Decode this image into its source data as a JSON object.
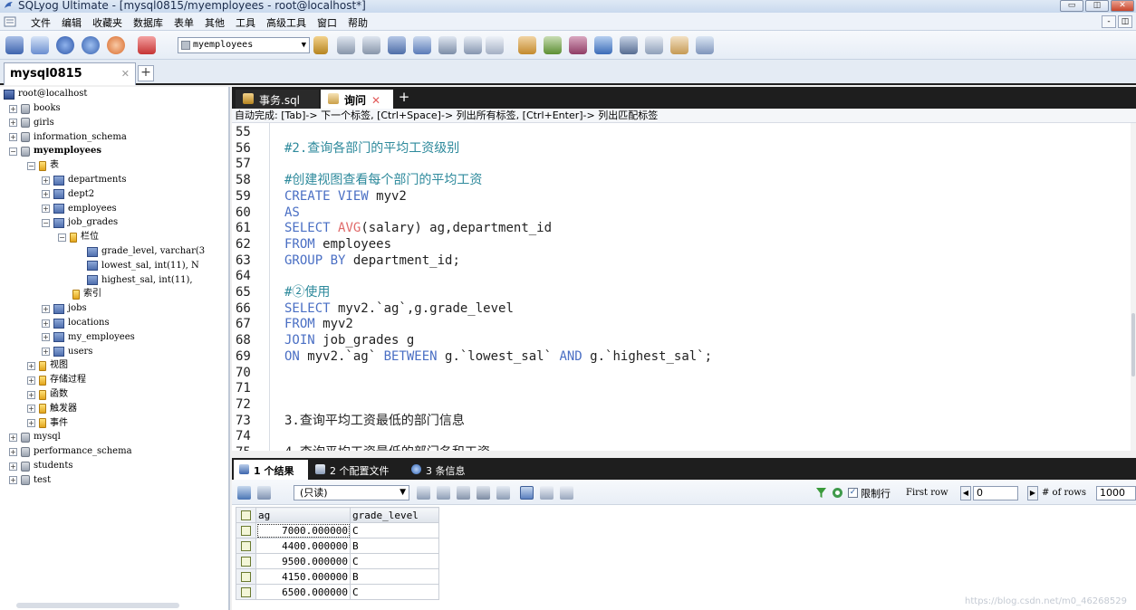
{
  "window": {
    "title": "SQLyog Ultimate - [mysql0815/myemployees - root@localhost*]",
    "buttons": [
      "▭",
      "◫",
      "✕"
    ]
  },
  "menu": {
    "items": [
      "文件",
      "编辑",
      "收藏夹",
      "数据库",
      "表单",
      "其他",
      "工具",
      "高级工具",
      "窗口",
      "帮助"
    ],
    "mdi_buttons": [
      "-",
      "◫"
    ]
  },
  "toolbar": {
    "database_select": "myemployees",
    "dropdown_arrow": "▼"
  },
  "connection_tabs": {
    "active": "mysql0815",
    "close": "✕",
    "add": "+"
  },
  "tree": {
    "server": "root@localhost",
    "nodes": [
      {
        "label": "books",
        "exp": "+",
        "type": "db"
      },
      {
        "label": "girls",
        "exp": "+",
        "type": "db"
      },
      {
        "label": "information_schema",
        "exp": "+",
        "type": "db"
      },
      {
        "label": "myemployees",
        "exp": "−",
        "type": "db"
      },
      {
        "label": "表",
        "exp": "−",
        "type": "folder"
      },
      {
        "label": "departments",
        "exp": "+",
        "type": "table"
      },
      {
        "label": "dept2",
        "exp": "+",
        "type": "table"
      },
      {
        "label": "employees",
        "exp": "+",
        "type": "table"
      },
      {
        "label": "job_grades",
        "exp": "−",
        "type": "table"
      },
      {
        "label": "栏位",
        "exp": "−",
        "type": "folder"
      },
      {
        "label": "grade_level, varchar(3",
        "exp": "",
        "type": "table"
      },
      {
        "label": "lowest_sal, int(11), N",
        "exp": "",
        "type": "table"
      },
      {
        "label": "highest_sal, int(11),",
        "exp": "",
        "type": "table"
      },
      {
        "label": "索引",
        "exp": "",
        "type": "folder"
      },
      {
        "label": "jobs",
        "exp": "+",
        "type": "table"
      },
      {
        "label": "locations",
        "exp": "+",
        "type": "table"
      },
      {
        "label": "my_employees",
        "exp": "+",
        "type": "table"
      },
      {
        "label": "users",
        "exp": "+",
        "type": "table"
      },
      {
        "label": "视图",
        "exp": "+",
        "type": "folder"
      },
      {
        "label": "存储过程",
        "exp": "+",
        "type": "folder"
      },
      {
        "label": "函数",
        "exp": "+",
        "type": "folder"
      },
      {
        "label": "触发器",
        "exp": "+",
        "type": "folder"
      },
      {
        "label": "事件",
        "exp": "+",
        "type": "folder"
      },
      {
        "label": "mysql",
        "exp": "+",
        "type": "db"
      },
      {
        "label": "performance_schema",
        "exp": "+",
        "type": "db"
      },
      {
        "label": "students",
        "exp": "+",
        "type": "db"
      },
      {
        "label": "test",
        "exp": "+",
        "type": "db"
      }
    ]
  },
  "query_tabs": {
    "inactive": "事务.sql",
    "active": "询问",
    "close": "✕",
    "add": "+"
  },
  "hint": "自动完成: [Tab]-> 下一个标签, [Ctrl+Space]-> 列出所有标签, [Ctrl+Enter]-> 列出匹配标签",
  "editor": {
    "lines": [
      {
        "n": "55",
        "html": ""
      },
      {
        "n": "56",
        "html": "<span class='cmt'>#2.查询各部门的平均工资级别</span>"
      },
      {
        "n": "57",
        "html": ""
      },
      {
        "n": "58",
        "html": "<span class='cmt'>#创建视图查看每个部门的平均工资</span>"
      },
      {
        "n": "59",
        "html": "<span class='kw'>CREATE VIEW</span> myv2"
      },
      {
        "n": "60",
        "html": "<span class='kw'>AS</span>"
      },
      {
        "n": "61",
        "html": "<span class='kw'>SELECT</span> <span class='fn'>AVG</span>(salary) ag,department_id"
      },
      {
        "n": "62",
        "html": "<span class='kw'>FROM</span> employees"
      },
      {
        "n": "63",
        "html": "<span class='kw'>GROUP BY</span> department_id;"
      },
      {
        "n": "64",
        "html": ""
      },
      {
        "n": "65",
        "html": "<span class='cmt'>#②使用</span>"
      },
      {
        "n": "66",
        "html": "<span class='kw'>SELECT</span> myv2.`ag`,g.grade_level"
      },
      {
        "n": "67",
        "html": "<span class='kw'>FROM</span> myv2"
      },
      {
        "n": "68",
        "html": "<span class='kw'>JOIN</span> job_grades g"
      },
      {
        "n": "69",
        "html": "<span class='kw'>ON</span> myv2.`ag` <span class='kw'>BETWEEN</span> g.`lowest_sal` <span class='kw'>AND</span> g.`highest_sal`;"
      },
      {
        "n": "70",
        "html": ""
      },
      {
        "n": "71",
        "html": ""
      },
      {
        "n": "72",
        "html": ""
      },
      {
        "n": "73",
        "html": "3.查询平均工资最低的部门信息"
      },
      {
        "n": "74",
        "html": ""
      },
      {
        "n": "75",
        "html": "4.查询平均工资最低的部门名和工资"
      }
    ]
  },
  "result_tabs": [
    "1 个结果",
    "2 个配置文件",
    "3 条信息"
  ],
  "result_toolbar": {
    "mode_select": "(只读)",
    "limit_label": "限制行",
    "first_row_label": "First row",
    "first_row_value": "0",
    "rows_label": "# of rows",
    "rows_value": "1000",
    "checked_mark": "✓",
    "prev": "◀",
    "next": "▶"
  },
  "result_grid": {
    "columns": [
      "ag",
      "grade_level"
    ],
    "rows": [
      [
        "7000.000000",
        "C"
      ],
      [
        "4400.000000",
        "B"
      ],
      [
        "9500.000000",
        "C"
      ],
      [
        "4150.000000",
        "B"
      ],
      [
        "6500.000000",
        "C"
      ]
    ]
  },
  "watermark": "https://blog.csdn.net/m0_46268529",
  "colors": {
    "keyword": "#4a6fc4",
    "function": "#e06a6a",
    "comment": "#2e8a9c"
  }
}
